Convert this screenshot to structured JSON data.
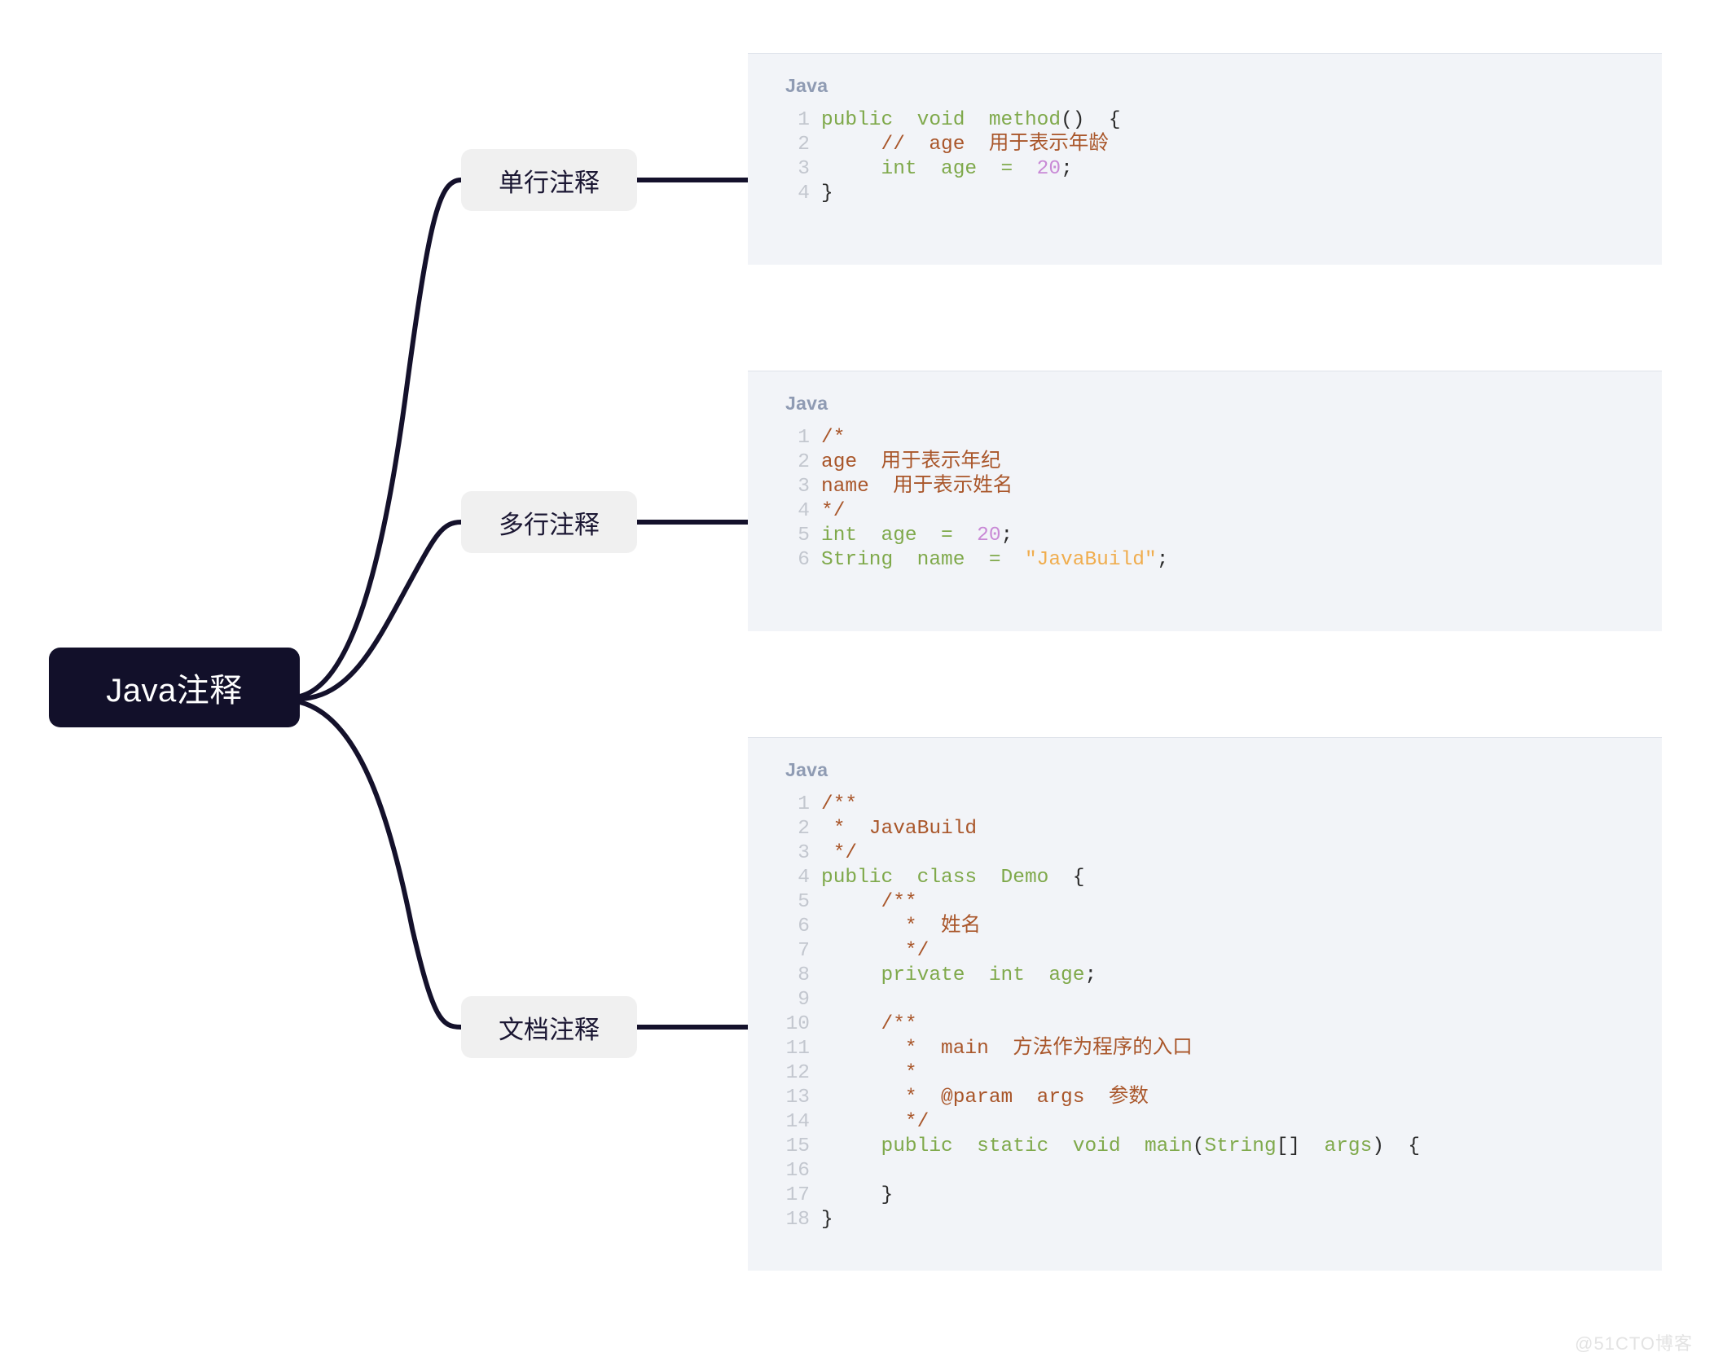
{
  "diagram": {
    "type": "mindmap",
    "root": {
      "label": "Java注释"
    },
    "branches": [
      {
        "label": "单行注释"
      },
      {
        "label": "多行注释"
      },
      {
        "label": "文档注释"
      }
    ]
  },
  "colors": {
    "root_bg": "#12102a",
    "branch_bg": "#f0f0f0",
    "edge": "#14112b",
    "card_bg": "#f2f4f8",
    "lang_label": "#8f9bb3",
    "line_number": "#c3c7cf",
    "keyword": "#7fa94b",
    "comment": "#a9562a",
    "number": "#c98ad6",
    "string": "#f0ad4e",
    "plain": "#2b2b2b",
    "canvas_bg": "#ffffff"
  },
  "code_cards": [
    {
      "lang": "Java",
      "lines": [
        {
          "n": "1",
          "tokens": [
            {
              "t": "kw",
              "s": "public  void  method"
            },
            {
              "t": "punc",
              "s": "()  {"
            }
          ]
        },
        {
          "n": "2",
          "tokens": [
            {
              "t": "plain",
              "s": "     "
            },
            {
              "t": "com",
              "s": "//  age  用于表示年龄"
            }
          ]
        },
        {
          "n": "3",
          "tokens": [
            {
              "t": "plain",
              "s": "     "
            },
            {
              "t": "kw",
              "s": "int  age  =  "
            },
            {
              "t": "num",
              "s": "20"
            },
            {
              "t": "punc",
              "s": ";"
            }
          ]
        },
        {
          "n": "4",
          "tokens": [
            {
              "t": "punc",
              "s": "}"
            }
          ]
        }
      ]
    },
    {
      "lang": "Java",
      "lines": [
        {
          "n": "1",
          "tokens": [
            {
              "t": "com",
              "s": "/*"
            }
          ]
        },
        {
          "n": "2",
          "tokens": [
            {
              "t": "com",
              "s": "age  用于表示年纪"
            }
          ]
        },
        {
          "n": "3",
          "tokens": [
            {
              "t": "com",
              "s": "name  用于表示姓名"
            }
          ]
        },
        {
          "n": "4",
          "tokens": [
            {
              "t": "com",
              "s": "*/"
            }
          ]
        },
        {
          "n": "5",
          "tokens": [
            {
              "t": "kw",
              "s": "int  age  =  "
            },
            {
              "t": "num",
              "s": "20"
            },
            {
              "t": "punc",
              "s": ";"
            }
          ]
        },
        {
          "n": "6",
          "tokens": [
            {
              "t": "kw",
              "s": "String  name  =  "
            },
            {
              "t": "str",
              "s": "\"JavaBuild\""
            },
            {
              "t": "punc",
              "s": ";"
            }
          ]
        }
      ]
    },
    {
      "lang": "Java",
      "lines": [
        {
          "n": "1",
          "tokens": [
            {
              "t": "com",
              "s": "/**"
            }
          ]
        },
        {
          "n": "2",
          "tokens": [
            {
              "t": "com",
              "s": " *  JavaBuild"
            }
          ]
        },
        {
          "n": "3",
          "tokens": [
            {
              "t": "com",
              "s": " */"
            }
          ]
        },
        {
          "n": "4",
          "tokens": [
            {
              "t": "kw",
              "s": "public  class  Demo  "
            },
            {
              "t": "punc",
              "s": "{"
            }
          ]
        },
        {
          "n": "5",
          "tokens": [
            {
              "t": "plain",
              "s": "     "
            },
            {
              "t": "com",
              "s": "/**"
            }
          ]
        },
        {
          "n": "6",
          "tokens": [
            {
              "t": "plain",
              "s": "     "
            },
            {
              "t": "com",
              "s": "  *  姓名"
            }
          ]
        },
        {
          "n": "7",
          "tokens": [
            {
              "t": "plain",
              "s": "     "
            },
            {
              "t": "com",
              "s": "  */"
            }
          ]
        },
        {
          "n": "8",
          "tokens": [
            {
              "t": "plain",
              "s": "     "
            },
            {
              "t": "kw",
              "s": "private  int  age"
            },
            {
              "t": "punc",
              "s": ";"
            }
          ]
        },
        {
          "n": "9",
          "tokens": [
            {
              "t": "plain",
              "s": ""
            }
          ]
        },
        {
          "n": "10",
          "tokens": [
            {
              "t": "plain",
              "s": "     "
            },
            {
              "t": "com",
              "s": "/**"
            }
          ]
        },
        {
          "n": "11",
          "tokens": [
            {
              "t": "plain",
              "s": "     "
            },
            {
              "t": "com",
              "s": "  *  main  方法作为程序的入口"
            }
          ]
        },
        {
          "n": "12",
          "tokens": [
            {
              "t": "plain",
              "s": "     "
            },
            {
              "t": "com",
              "s": "  *"
            }
          ]
        },
        {
          "n": "13",
          "tokens": [
            {
              "t": "plain",
              "s": "     "
            },
            {
              "t": "com",
              "s": "  *  @param  args  参数"
            }
          ]
        },
        {
          "n": "14",
          "tokens": [
            {
              "t": "plain",
              "s": "     "
            },
            {
              "t": "com",
              "s": "  */"
            }
          ]
        },
        {
          "n": "15",
          "tokens": [
            {
              "t": "plain",
              "s": "     "
            },
            {
              "t": "kw",
              "s": "public  static  void  main"
            },
            {
              "t": "punc",
              "s": "("
            },
            {
              "t": "kw",
              "s": "String"
            },
            {
              "t": "punc",
              "s": "[]  "
            },
            {
              "t": "kw",
              "s": "args"
            },
            {
              "t": "punc",
              "s": ")  {"
            }
          ]
        },
        {
          "n": "16",
          "tokens": [
            {
              "t": "plain",
              "s": ""
            }
          ]
        },
        {
          "n": "17",
          "tokens": [
            {
              "t": "plain",
              "s": "     "
            },
            {
              "t": "punc",
              "s": "}"
            }
          ]
        },
        {
          "n": "18",
          "tokens": [
            {
              "t": "punc",
              "s": "}"
            }
          ]
        }
      ]
    }
  ],
  "watermark": {
    "text": "@51CTO博客"
  }
}
